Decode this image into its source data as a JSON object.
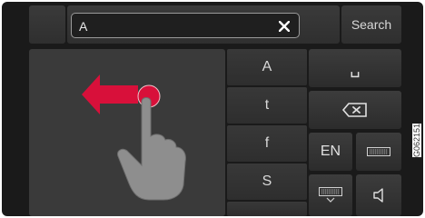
{
  "search": {
    "value": "A",
    "button_label": "Search"
  },
  "suggestions": [
    "A",
    "t",
    "f",
    "S"
  ],
  "keys": {
    "space_label": "␣",
    "language_label": "EN"
  },
  "figure_code": "G062151",
  "colors": {
    "arrow": "#d8103a",
    "hand": "#8e8e8e",
    "background": "#1a1a1a"
  }
}
